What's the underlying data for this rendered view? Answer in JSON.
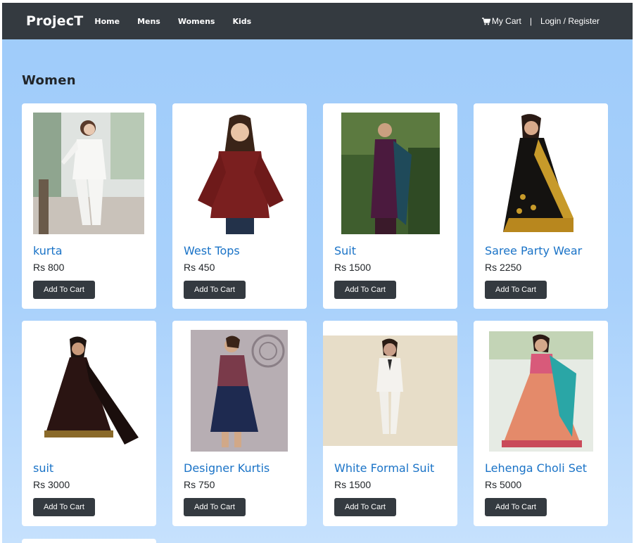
{
  "nav": {
    "brand": "ProjecT",
    "links": [
      "Home",
      "Mens",
      "Womens",
      "Kids"
    ],
    "cart_label": "My Cart",
    "separator": "|",
    "login_label": "Login / Register"
  },
  "section": {
    "title": "Women"
  },
  "cart_button_label": "Add To Cart",
  "products": [
    {
      "name": "kurta",
      "price": "Rs 800",
      "icon": "white-pant-suit-image"
    },
    {
      "name": "West Tops",
      "price": "Rs 450",
      "icon": "maroon-top-image"
    },
    {
      "name": "Suit",
      "price": "Rs 1500",
      "icon": "purple-suit-image"
    },
    {
      "name": "Saree Party Wear",
      "price": "Rs 2250",
      "icon": "black-gold-saree-image"
    },
    {
      "name": "suit",
      "price": "Rs 3000",
      "icon": "black-anarkali-image"
    },
    {
      "name": "Designer Kurtis",
      "price": "Rs 750",
      "icon": "blue-kurti-image"
    },
    {
      "name": "White Formal Suit",
      "price": "Rs 1500",
      "icon": "white-formal-suit-image"
    },
    {
      "name": "Lehenga Choli Set",
      "price": "Rs 5000",
      "icon": "lehenga-image"
    }
  ],
  "colors": {
    "navbar": "#343a40",
    "link": "#1a73c7",
    "background": "#a9d1fb",
    "button": "#343a40"
  }
}
